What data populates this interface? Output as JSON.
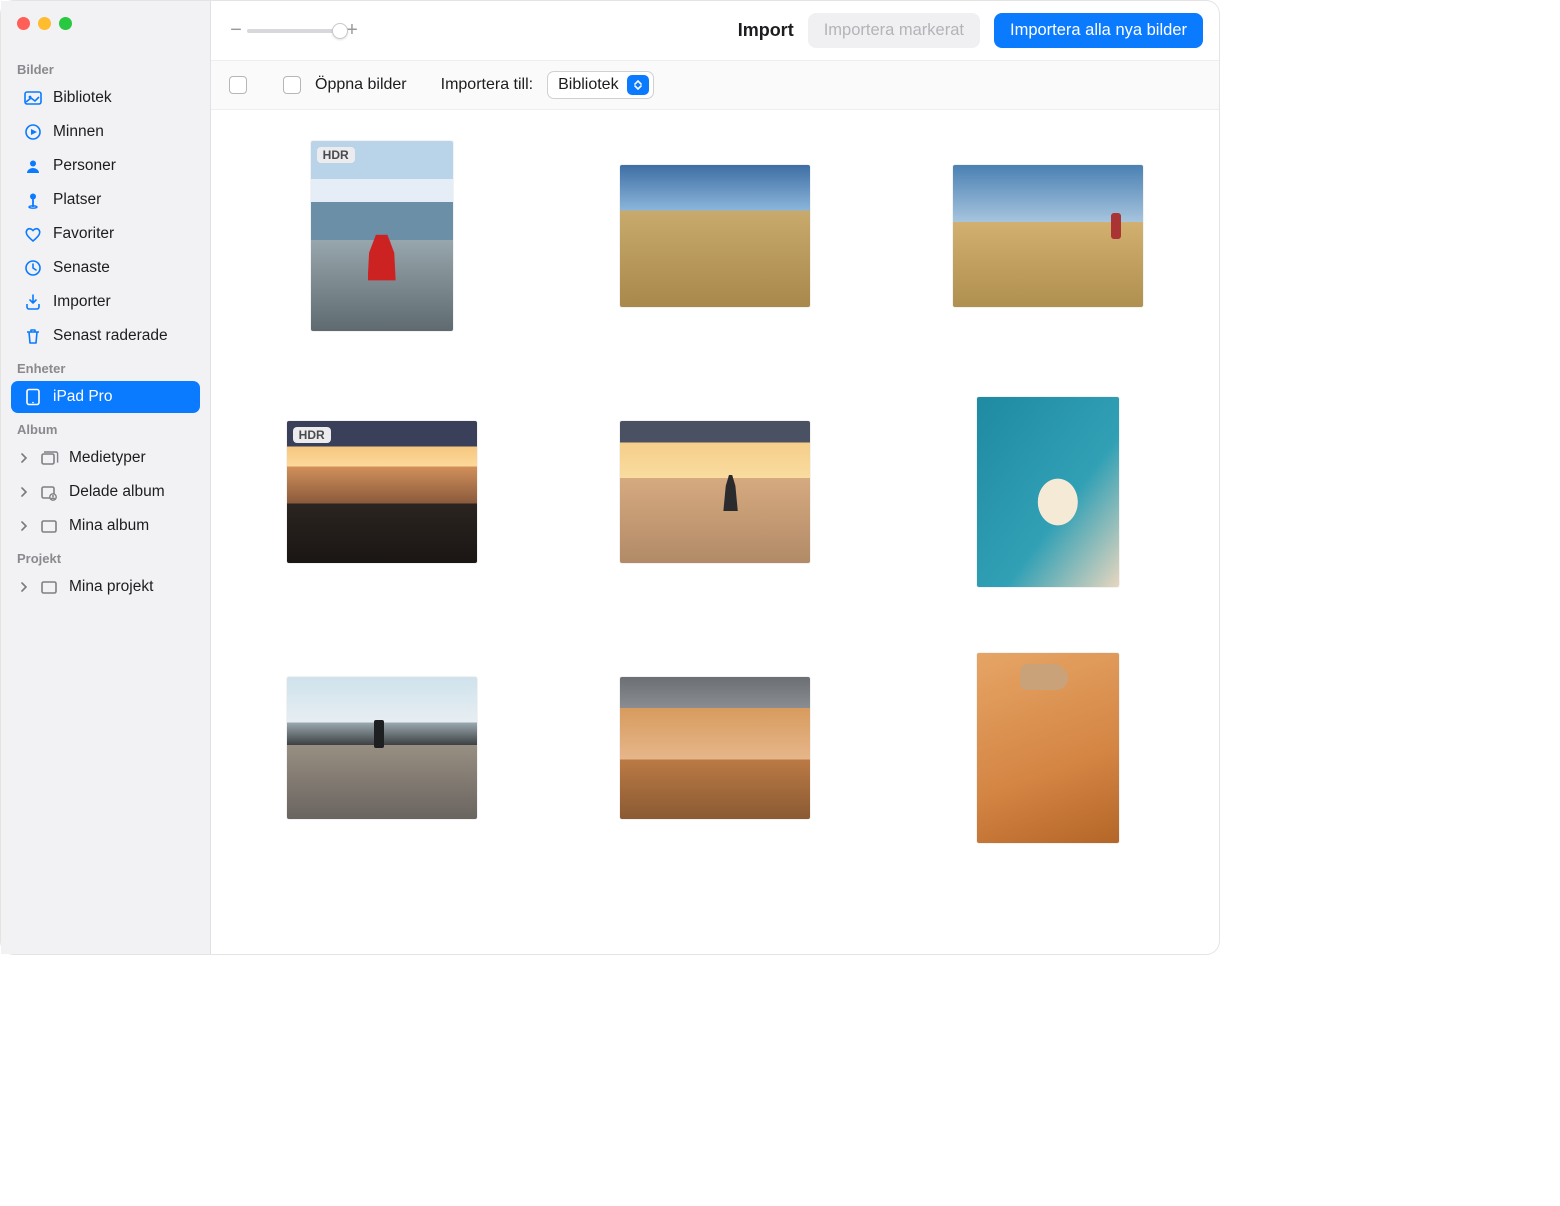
{
  "sidebar": {
    "sections": {
      "bilder": {
        "label": "Bilder",
        "items": [
          {
            "label": "Bibliotek"
          },
          {
            "label": "Minnen"
          },
          {
            "label": "Personer"
          },
          {
            "label": "Platser"
          },
          {
            "label": "Favoriter"
          },
          {
            "label": "Senaste"
          },
          {
            "label": "Importer"
          },
          {
            "label": "Senast raderade"
          }
        ]
      },
      "enheter": {
        "label": "Enheter",
        "items": [
          {
            "label": "iPad Pro"
          }
        ]
      },
      "album": {
        "label": "Album",
        "items": [
          {
            "label": "Medietyper"
          },
          {
            "label": "Delade album"
          },
          {
            "label": "Mina album"
          }
        ]
      },
      "projekt": {
        "label": "Projekt",
        "items": [
          {
            "label": "Mina projekt"
          }
        ]
      }
    }
  },
  "toolbar": {
    "title": "Import",
    "import_selected_label": "Importera markerat",
    "import_all_label": "Importera alla nya bilder"
  },
  "subbar": {
    "open_photos_label": "Öppna bilder",
    "destination_label": "Importera till:",
    "destination_value": "Bibliotek"
  },
  "grid": {
    "hdr_label": "HDR",
    "items": [
      {
        "orientation": "portrait",
        "hdr": true
      },
      {
        "orientation": "landscape",
        "hdr": false
      },
      {
        "orientation": "landscape",
        "hdr": false
      },
      {
        "orientation": "landscape",
        "hdr": true
      },
      {
        "orientation": "landscape",
        "hdr": false
      },
      {
        "orientation": "portrait",
        "hdr": false
      },
      {
        "orientation": "landscape",
        "hdr": false
      },
      {
        "orientation": "landscape",
        "hdr": false
      },
      {
        "orientation": "portrait",
        "hdr": false
      }
    ]
  }
}
